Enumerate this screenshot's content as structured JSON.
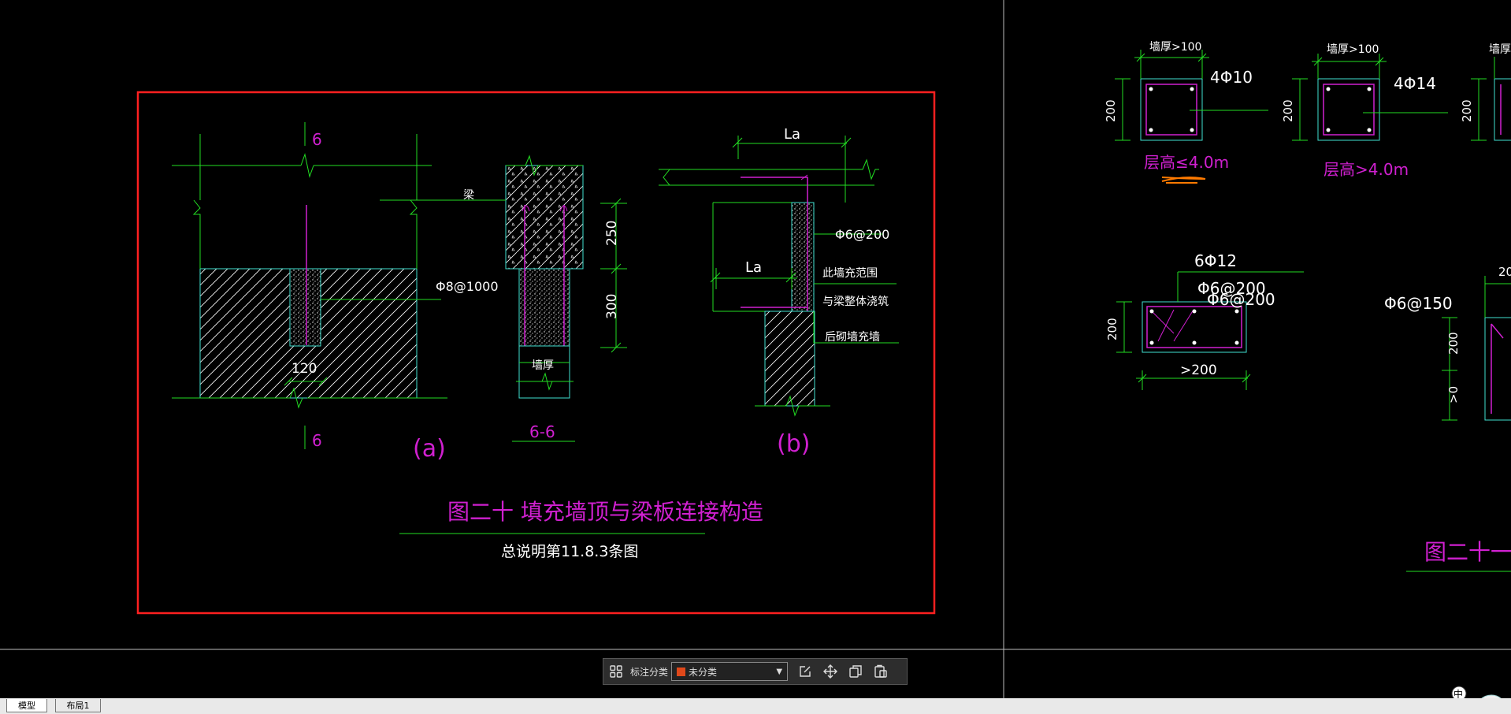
{
  "drawing": {
    "figure20": {
      "section_mark": "6",
      "dim_120": "120",
      "label_beam": "梁",
      "label_rebar_a": "Φ8@1000",
      "dim_250": "250",
      "dim_300": "300",
      "label_wall_thickness": "墙厚",
      "section_title": "6-6",
      "label_a": "(a)",
      "label_La": "La",
      "label_stirrup": "Φ6@200",
      "note_1": "此墙充范围",
      "note_2": "与梁整体浇筑",
      "note_3": "后砌墙充墙",
      "label_b": "(b)",
      "title": "图二十 填充墙顶与梁板连接构造",
      "subtitle": "总说明第11.8.3条图"
    },
    "figure21": {
      "wall_thk_1": "墙厚>100",
      "wall_thk_2": "墙厚>100",
      "wall_thk_3": "墙厚>",
      "dim_200": "200",
      "rebar_1": "4Φ10",
      "rebar_2": "4Φ14",
      "height_le": "层高≤4.0m",
      "height_gt": "层高>4.0m",
      "rebar_6_12": "6Φ12",
      "stirrup_1": "Φ6@200",
      "stirrup_2": "Φ6@200",
      "stirrup_3": "Φ6@150",
      "width_gt": ">200",
      "dim_20": "20",
      "dim_gt0": ">0",
      "title_partial": "图二十一",
      "ime_char": "中"
    }
  },
  "toolbar": {
    "label": "标注分类",
    "category_value": "未分类",
    "swatch_color": "#e0481a"
  },
  "tabs": [
    {
      "label": "模型",
      "active": true
    },
    {
      "label": "布局1",
      "active": false
    }
  ],
  "colors": {
    "frame": "#ff2020",
    "dimension": "#22dd22",
    "outline": "#40e0d0",
    "rebar": "#d020d0",
    "text_white": "#ffffff",
    "background": "#000000"
  }
}
